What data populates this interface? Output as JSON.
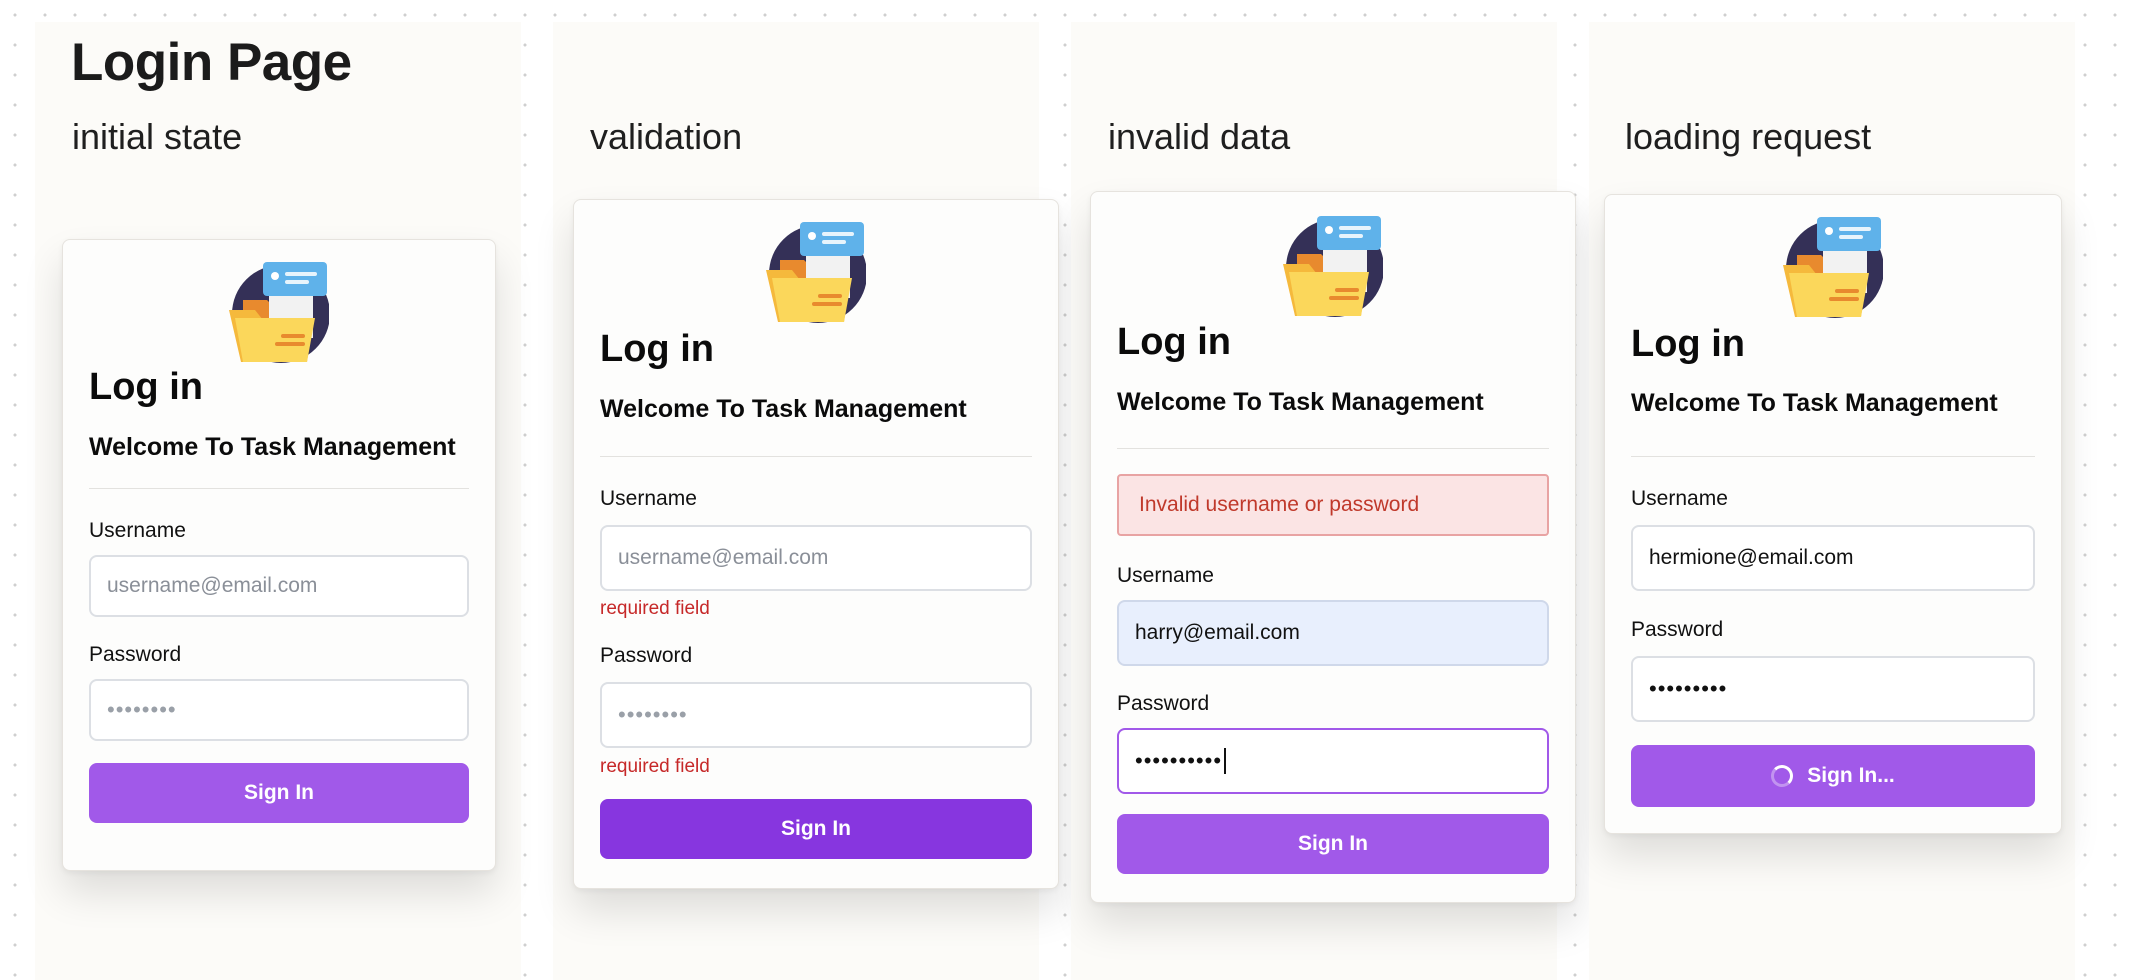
{
  "page": {
    "title": "Login Page"
  },
  "columns": [
    {
      "label": "initial state",
      "card": {
        "heading": "Log in",
        "subtitle": "Welcome To Task Management",
        "username_label": "Username",
        "username_placeholder": "username@email.com",
        "password_label": "Password",
        "password_mask": "••••••••",
        "button_label": "Sign In"
      }
    },
    {
      "label": "validation",
      "card": {
        "heading": "Log in",
        "subtitle": "Welcome To Task Management",
        "username_label": "Username",
        "username_placeholder": "username@email.com",
        "username_error": "required field",
        "password_label": "Password",
        "password_mask": "••••••••",
        "password_error": "required field",
        "button_label": "Sign In"
      }
    },
    {
      "label": "invalid data",
      "card": {
        "heading": "Log in",
        "subtitle": "Welcome To Task Management",
        "alert": "Invalid username or password",
        "username_label": "Username",
        "username_value": "harry@email.com",
        "password_label": "Password",
        "password_value": "••••••••••",
        "button_label": "Sign In"
      }
    },
    {
      "label": "loading request",
      "card": {
        "heading": "Log in",
        "subtitle": "Welcome To Task Management",
        "username_label": "Username",
        "username_value": "hermione@email.com",
        "password_label": "Password",
        "password_value": "•••••••••",
        "button_label": "Sign In..."
      }
    }
  ],
  "icons": {
    "logo": "folder-document-icon",
    "spinner": "loading-spinner-icon"
  },
  "colors": {
    "accent": "#a159e9",
    "accent_pressed": "#8736df",
    "error": "#c62828",
    "alert_background": "#fbe4e4",
    "autofill_background": "#e8effd"
  }
}
